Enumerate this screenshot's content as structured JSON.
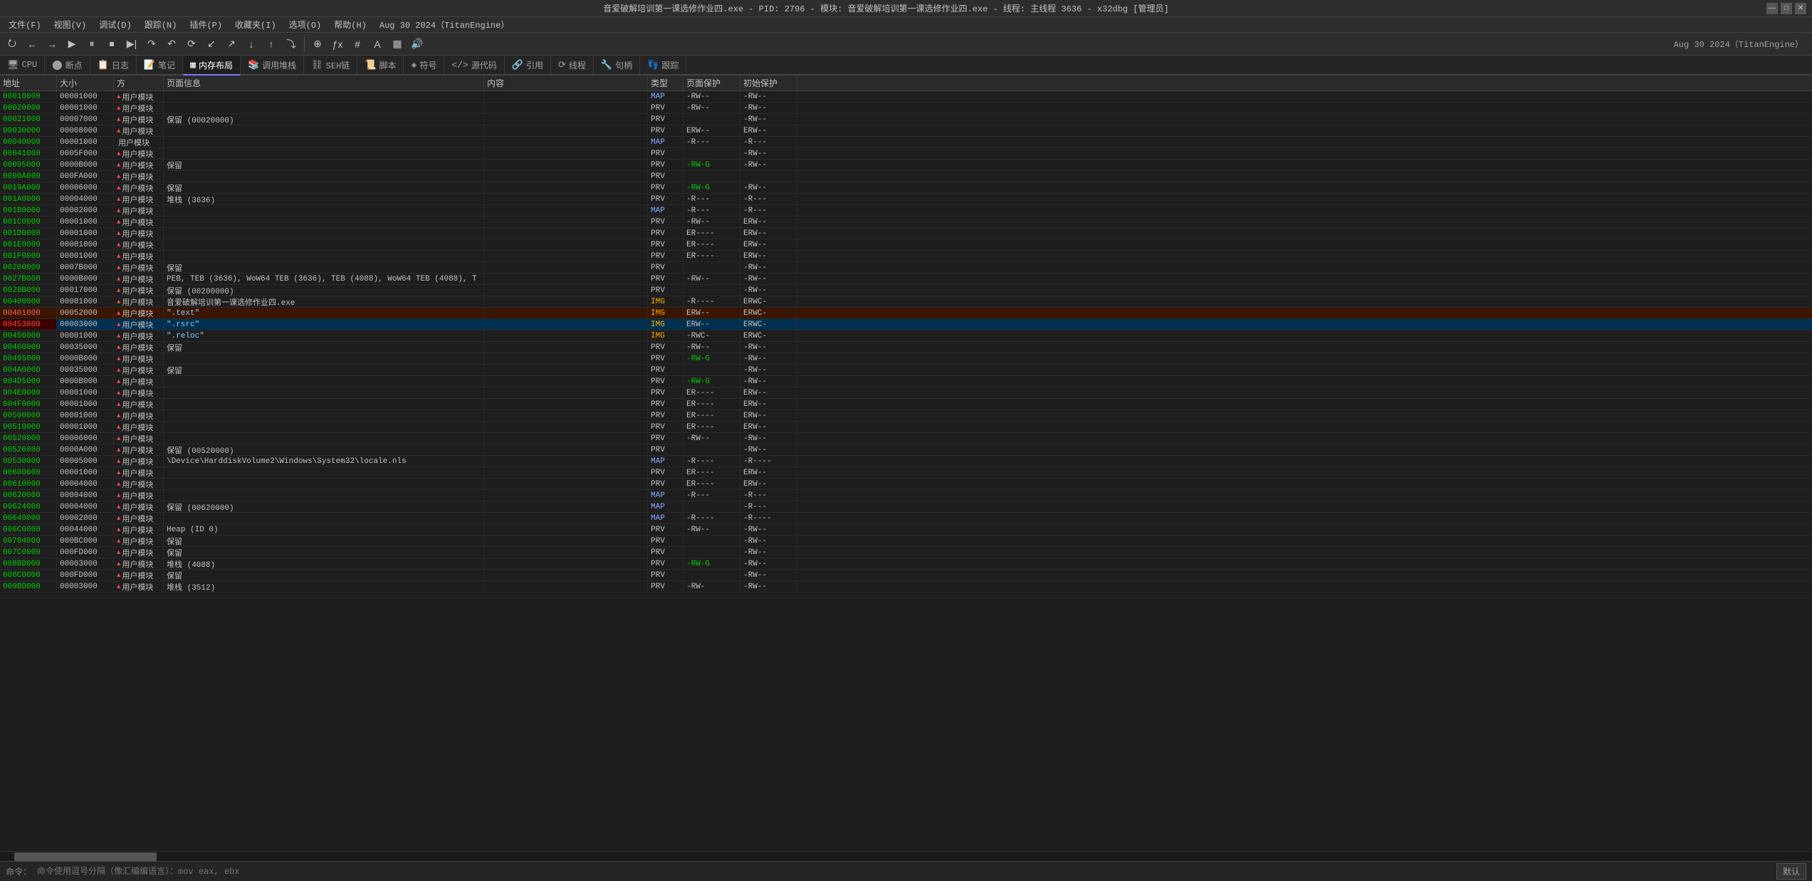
{
  "titleBar": {
    "text": "音爱破解培训第一课选修作业四.exe - PID: 2796 - 模块: 音爱破解培训第一课选修作业四.exe - 线程: 主线程 3636 - x32dbg [管理员]",
    "minBtn": "—",
    "maxBtn": "□",
    "closeBtn": "✕"
  },
  "menuBar": {
    "items": [
      {
        "label": "文件(F)"
      },
      {
        "label": "视图(V)"
      },
      {
        "label": "调试(D)"
      },
      {
        "label": "跟踪(N)"
      },
      {
        "label": "插件(P)"
      },
      {
        "label": "收藏夹(I)"
      },
      {
        "label": "选项(O)"
      },
      {
        "label": "帮助(H)"
      },
      {
        "label": "Aug 30 2024（TitanEngine）"
      }
    ]
  },
  "toolbar": {
    "buttons": [
      "⭮",
      "←",
      "→",
      "▶",
      "⏸",
      "⏹",
      "▶|",
      "↷",
      "↶",
      "⟳",
      "↙",
      "↗",
      "↓",
      "↑",
      "⤵",
      "⊕",
      "ƒx",
      "#",
      "A",
      "▦",
      "🔊"
    ]
  },
  "tabs": [
    {
      "id": "cpu",
      "label": "CPU",
      "icon": "🖥",
      "active": false
    },
    {
      "id": "breakpoint",
      "label": "断点",
      "icon": "●",
      "active": false
    },
    {
      "id": "log",
      "label": "日志",
      "icon": "📋",
      "active": false
    },
    {
      "id": "notes",
      "label": "笔记",
      "icon": "📝",
      "active": false
    },
    {
      "id": "memory",
      "label": "内存布局",
      "icon": "▦",
      "active": true
    },
    {
      "id": "callstack",
      "label": "调用堆栈",
      "icon": "📚",
      "active": false
    },
    {
      "id": "seh",
      "label": "SEH链",
      "icon": "⛓",
      "active": false
    },
    {
      "id": "script",
      "label": "脚本",
      "icon": "📜",
      "active": false
    },
    {
      "id": "symbol",
      "label": "符号",
      "icon": "⊕",
      "active": false
    },
    {
      "id": "source",
      "label": "源代码",
      "icon": "</>",
      "active": false
    },
    {
      "id": "reference",
      "label": "引用",
      "icon": "🔗",
      "active": false
    },
    {
      "id": "thread",
      "label": "线程",
      "icon": "⟲",
      "active": false
    },
    {
      "id": "handle",
      "label": "句柄",
      "icon": "🔧",
      "active": false
    },
    {
      "id": "trace",
      "label": "跟踪",
      "icon": "👣",
      "active": false
    }
  ],
  "columns": [
    {
      "label": "地址",
      "class": "w-addr"
    },
    {
      "label": "大小",
      "class": "w-size"
    },
    {
      "label": "方",
      "class": "w-dir"
    },
    {
      "label": "页面信息",
      "class": "w-page"
    },
    {
      "label": "内容",
      "class": "w-cont"
    },
    {
      "label": "类型",
      "class": "w-type"
    },
    {
      "label": "页面保护",
      "class": "w-prot"
    },
    {
      "label": "初始保护",
      "class": "w-init"
    }
  ],
  "rows": [
    {
      "addr": "00010000",
      "size": "00001000",
      "dir": "用户模块",
      "page": "",
      "cont": "",
      "type": "MAP",
      "prot": "-RW--",
      "init": "-RW--",
      "sel": false,
      "red": false
    },
    {
      "addr": "00020000",
      "size": "00001000",
      "dir": "用户模块",
      "page": "",
      "cont": "",
      "type": "PRV",
      "prot": "-RW--",
      "init": "-RW--",
      "sel": false,
      "red": false
    },
    {
      "addr": "00021000",
      "size": "00007000",
      "dir": "用户模块",
      "page": "保留 (00020000)",
      "cont": "",
      "type": "PRV",
      "prot": "",
      "init": "-RW--",
      "sel": false,
      "red": false
    },
    {
      "addr": "00030000",
      "size": "00008000",
      "dir": "用户模块",
      "page": "",
      "cont": "",
      "type": "PRV",
      "prot": "ERW--",
      "init": "ERW--",
      "sel": false,
      "red": false
    },
    {
      "addr": "00040000",
      "size": "00001000",
      "dir": "用户模块",
      "page": "",
      "cont": "",
      "type": "MAP",
      "prot": "-R---",
      "init": "-R---",
      "sel": false,
      "red": false
    },
    {
      "addr": "00041000",
      "size": "0005F000",
      "dir": "用户模块",
      "page": "",
      "cont": "",
      "type": "PRV",
      "prot": "",
      "init": "-RW--",
      "sel": false,
      "red": false
    },
    {
      "addr": "00095000",
      "size": "0000B000",
      "dir": "用户模块",
      "page": "保留",
      "cont": "",
      "type": "PRV",
      "prot": "-RW-G",
      "init": "-RW--",
      "sel": false,
      "red": false
    },
    {
      "addr": "0000A000",
      "size": "000FA000",
      "dir": "用户模块",
      "page": "",
      "cont": "",
      "type": "PRV",
      "prot": "",
      "init": "",
      "sel": false,
      "red": false
    },
    {
      "addr": "0019A000",
      "size": "00006000",
      "dir": "用户模块",
      "page": "保留",
      "cont": "",
      "type": "PRV",
      "prot": "-RW-G",
      "init": "-RW--",
      "sel": false,
      "red": false
    },
    {
      "addr": "001A0000",
      "size": "00004000",
      "dir": "用户模块",
      "page": "堆栈 (3636)",
      "cont": "",
      "type": "PRV",
      "prot": "-R---",
      "init": "-R---",
      "sel": false,
      "red": false
    },
    {
      "addr": "001B0000",
      "size": "00002000",
      "dir": "用户模块",
      "page": "",
      "cont": "",
      "type": "MAP",
      "prot": "-R---",
      "init": "-R---",
      "sel": false,
      "red": false
    },
    {
      "addr": "001C0000",
      "size": "00001000",
      "dir": "用户模块",
      "page": "",
      "cont": "",
      "type": "PRV",
      "prot": "-RW--",
      "init": "ERW--",
      "sel": false,
      "red": false
    },
    {
      "addr": "001D0000",
      "size": "00001000",
      "dir": "用户模块",
      "page": "",
      "cont": "",
      "type": "PRV",
      "prot": "ER----",
      "init": "ERW--",
      "sel": false,
      "red": false
    },
    {
      "addr": "001E0000",
      "size": "00001000",
      "dir": "用户模块",
      "page": "",
      "cont": "",
      "type": "PRV",
      "prot": "ER----",
      "init": "ERW--",
      "sel": false,
      "red": false
    },
    {
      "addr": "001F0000",
      "size": "00001000",
      "dir": "用户模块",
      "page": "",
      "cont": "",
      "type": "PRV",
      "prot": "ER----",
      "init": "ERW--",
      "sel": false,
      "red": false
    },
    {
      "addr": "00200000",
      "size": "0007B000",
      "dir": "用户模块",
      "page": "保留",
      "cont": "",
      "type": "PRV",
      "prot": "",
      "init": "-RW--",
      "sel": false,
      "red": false
    },
    {
      "addr": "0027B000",
      "size": "0000B000",
      "dir": "用户模块",
      "page": "PEB, TEB (3636), WoW64 TEB (3636), TEB (4088), WoW64 TEB (4088), T",
      "cont": "",
      "type": "PRV",
      "prot": "-RW--",
      "init": "-RW--",
      "sel": false,
      "red": false
    },
    {
      "addr": "0028B000",
      "size": "00017000",
      "dir": "用户模块",
      "page": "保留 (00200000)",
      "cont": "",
      "type": "PRV",
      "prot": "",
      "init": "-RW--",
      "sel": false,
      "red": false
    },
    {
      "addr": "00400000",
      "size": "00001000",
      "dir": "用户模块",
      "page": "音爱破解培训第一课选修作业四.exe",
      "cont": "",
      "type": "IMG",
      "prot": "-R----",
      "init": "ERWC-",
      "sel": false,
      "red": false
    },
    {
      "addr": "00401000",
      "size": "00052000",
      "dir": "用户模块",
      "page": "  \".text\"",
      "cont": "",
      "type": "IMG",
      "prot": "ERW--",
      "init": "ERWC-",
      "sel": false,
      "red": true,
      "selected": true
    },
    {
      "addr": "00453000",
      "size": "00003000",
      "dir": "用户模块",
      "page": "  \".rsrc\"",
      "cont": "",
      "type": "IMG",
      "prot": "ERW--",
      "init": "ERWC-",
      "sel": false,
      "red": false,
      "active_row": true
    },
    {
      "addr": "00456000",
      "size": "00001000",
      "dir": "用户模块",
      "page": "  \".reloc\"",
      "cont": "",
      "type": "IMG",
      "prot": "-RWC-",
      "init": "ERWC-",
      "sel": false,
      "red": false
    },
    {
      "addr": "00460000",
      "size": "00035000",
      "dir": "用户模块",
      "page": "保留",
      "cont": "",
      "type": "PRV",
      "prot": "-RW--",
      "init": "-RW--",
      "sel": false,
      "red": false
    },
    {
      "addr": "00495000",
      "size": "0000B000",
      "dir": "用户模块",
      "page": "",
      "cont": "",
      "type": "PRV",
      "prot": "-RW-G",
      "init": "-RW--",
      "sel": false,
      "red": false
    },
    {
      "addr": "004A0000",
      "size": "00035000",
      "dir": "用户模块",
      "page": "保留",
      "cont": "",
      "type": "PRV",
      "prot": "",
      "init": "-RW--",
      "sel": false,
      "red": false
    },
    {
      "addr": "004D5000",
      "size": "0000B000",
      "dir": "用户模块",
      "page": "",
      "cont": "",
      "type": "PRV",
      "prot": "-RW-G",
      "init": "-RW--",
      "sel": false,
      "red": false
    },
    {
      "addr": "004E0000",
      "size": "00001000",
      "dir": "用户模块",
      "page": "",
      "cont": "",
      "type": "PRV",
      "prot": "ER----",
      "init": "ERW--",
      "sel": false,
      "red": false
    },
    {
      "addr": "004F0000",
      "size": "00001000",
      "dir": "用户模块",
      "page": "",
      "cont": "",
      "type": "PRV",
      "prot": "ER----",
      "init": "ERW--",
      "sel": false,
      "red": false
    },
    {
      "addr": "00500000",
      "size": "00001000",
      "dir": "用户模块",
      "page": "",
      "cont": "",
      "type": "PRV",
      "prot": "ER----",
      "init": "ERW--",
      "sel": false,
      "red": false
    },
    {
      "addr": "00510000",
      "size": "00001000",
      "dir": "用户模块",
      "page": "",
      "cont": "",
      "type": "PRV",
      "prot": "ER----",
      "init": "ERW--",
      "sel": false,
      "red": false
    },
    {
      "addr": "00520000",
      "size": "00006000",
      "dir": "用户模块",
      "page": "",
      "cont": "",
      "type": "PRV",
      "prot": "-RW--",
      "init": "-RW--",
      "sel": false,
      "red": false
    },
    {
      "addr": "00526000",
      "size": "0000A000",
      "dir": "用户模块",
      "page": "保留 (00520000)",
      "cont": "",
      "type": "PRV",
      "prot": "",
      "init": "-RW--",
      "sel": false,
      "red": false
    },
    {
      "addr": "00530000",
      "size": "00005000",
      "dir": "用户模块",
      "page": "\\Device\\HarddiskVolume2\\Windows\\System32\\locale.nls",
      "cont": "",
      "type": "MAP",
      "prot": "-R----",
      "init": "-R----",
      "sel": false,
      "red": false
    },
    {
      "addr": "00600000",
      "size": "00001000",
      "dir": "用户模块",
      "page": "",
      "cont": "",
      "type": "PRV",
      "prot": "ER----",
      "init": "ERW--",
      "sel": false,
      "red": false
    },
    {
      "addr": "00610000",
      "size": "00004000",
      "dir": "用户模块",
      "page": "",
      "cont": "",
      "type": "PRV",
      "prot": "ER----",
      "init": "ERW--",
      "sel": false,
      "red": false
    },
    {
      "addr": "00620000",
      "size": "00004000",
      "dir": "用户模块",
      "page": "",
      "cont": "",
      "type": "MAP",
      "prot": "-R---",
      "init": "-R---",
      "sel": false,
      "red": false
    },
    {
      "addr": "00624000",
      "size": "00004000",
      "dir": "用户模块",
      "page": "保留 (00620000)",
      "cont": "",
      "type": "MAP",
      "prot": "",
      "init": "-R---",
      "sel": false,
      "red": false
    },
    {
      "addr": "00640000",
      "size": "00002000",
      "dir": "用户模块",
      "page": "",
      "cont": "",
      "type": "MAP",
      "prot": "-R----",
      "init": "-R----",
      "sel": false,
      "red": false
    },
    {
      "addr": "006C0000",
      "size": "00044000",
      "dir": "用户模块",
      "page": "Heap (ID 0)",
      "cont": "",
      "type": "PRV",
      "prot": "-RW--",
      "init": "-RW--",
      "sel": false,
      "red": false
    },
    {
      "addr": "00704000",
      "size": "000BC000",
      "dir": "用户模块",
      "page": "保留",
      "cont": "",
      "type": "PRV",
      "prot": "",
      "init": "-RW--",
      "sel": false,
      "red": false
    },
    {
      "addr": "007C0000",
      "size": "000FD000",
      "dir": "用户模块",
      "page": "保留",
      "cont": "",
      "type": "PRV",
      "prot": "",
      "init": "-RW--",
      "sel": false,
      "red": false
    },
    {
      "addr": "008BD000",
      "size": "00003000",
      "dir": "用户模块",
      "page": "堆栈 (4088)",
      "cont": "",
      "type": "PRV",
      "prot": "-RW-G",
      "init": "-RW--",
      "sel": false,
      "red": false
    },
    {
      "addr": "008C0000",
      "size": "000FD000",
      "dir": "用户模块",
      "page": "保留",
      "cont": "",
      "type": "PRV",
      "prot": "",
      "init": "-RW--",
      "sel": false,
      "red": false
    },
    {
      "addr": "009BD000",
      "size": "00003000",
      "dir": "用户模块",
      "page": "堆栈 (3512)",
      "cont": "",
      "type": "PRV",
      "prot": "-RW-",
      "init": "-RW--",
      "sel": false,
      "red": false
    }
  ],
  "statusBar": {
    "cmdLabel": "命令：",
    "cmdHint": "命令使用逗号分隔（像汇编编语言）：mov eax, ebx",
    "defaultBtn": "默认"
  }
}
